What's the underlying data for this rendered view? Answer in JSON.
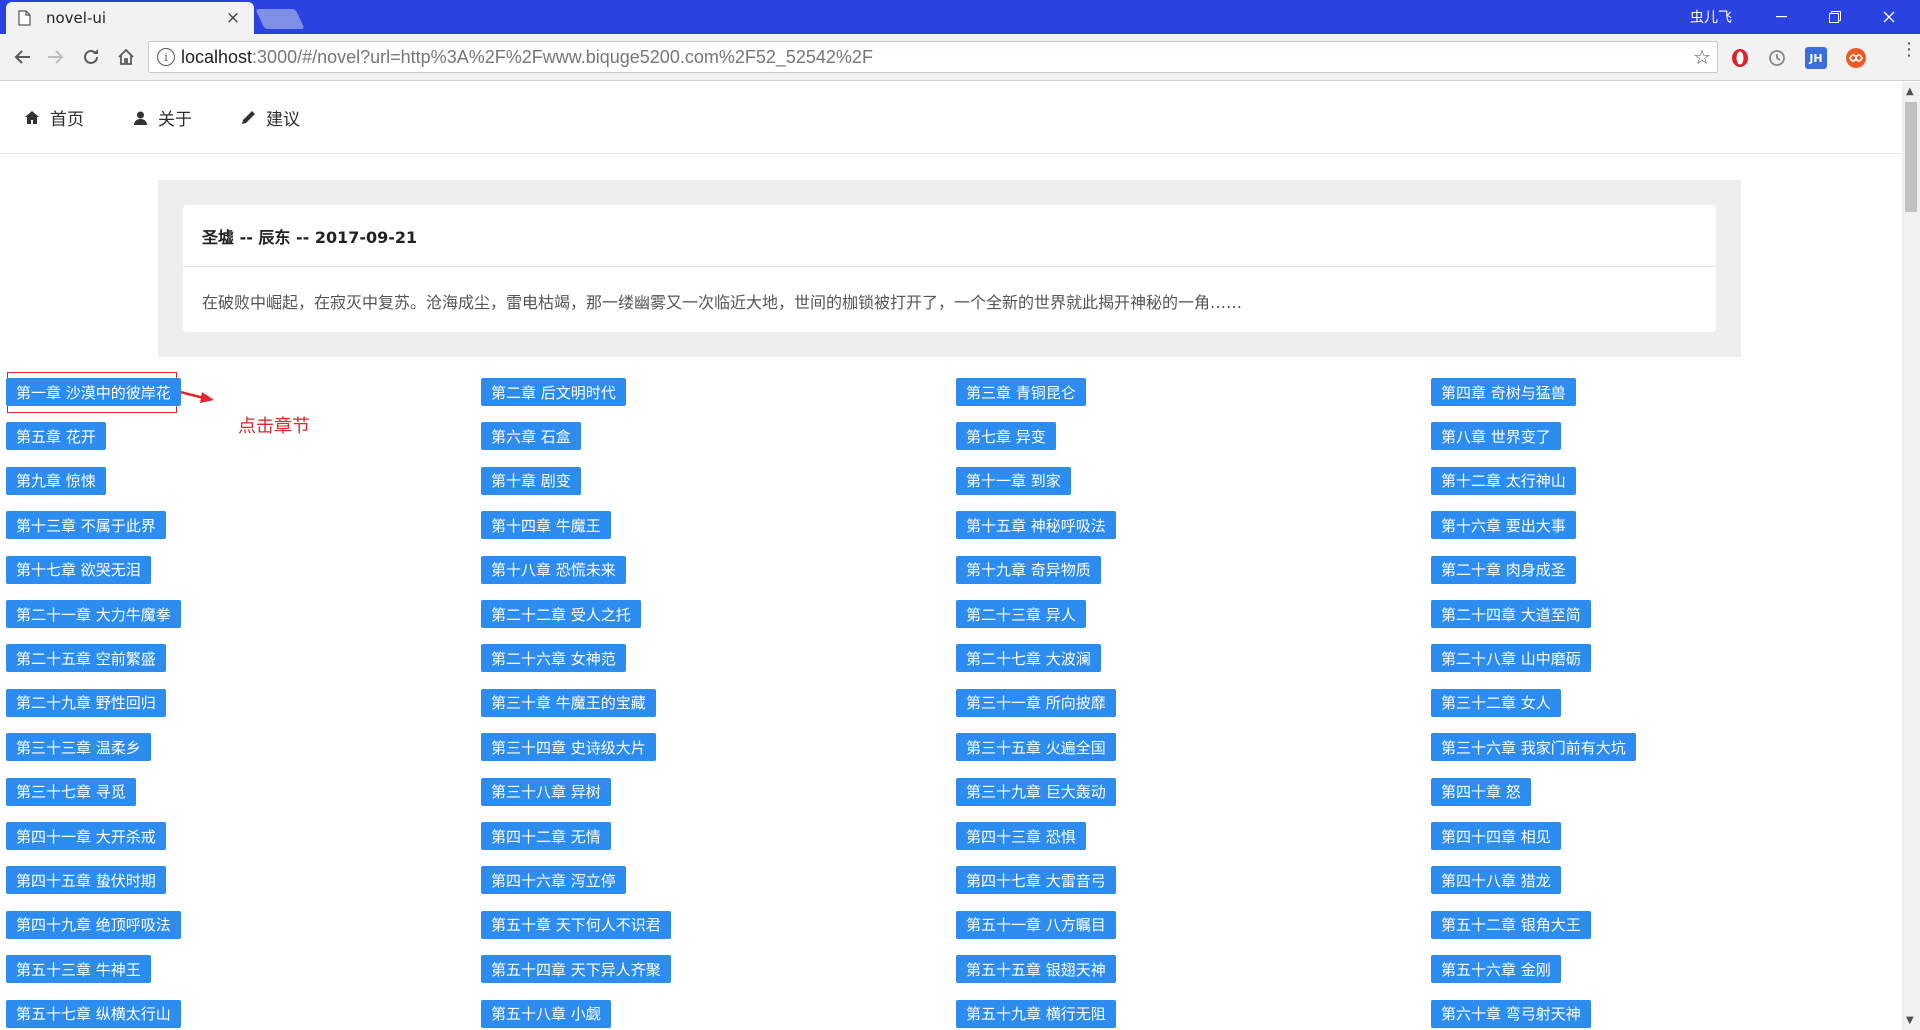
{
  "browser": {
    "tab_title": "novel-ui",
    "tab_close": "×",
    "profile_name": "虫儿飞",
    "url_host": "localhost",
    "url_rest": ":3000/#/novel?url=http%3A%2F%2Fwww.biquge5200.com%2F52_52542%2F",
    "extensions": [
      "opera-icon",
      "history-icon",
      "JH",
      "infinity-icon"
    ]
  },
  "nav": {
    "home": "首页",
    "about": "关于",
    "suggest": "建议"
  },
  "book": {
    "header": "圣墟 -- 辰东 -- 2017-09-21",
    "intro": "在破败中崛起，在寂灭中复苏。沧海成尘，雷电枯竭，那一缕幽雾又一次临近大地，世间的枷锁被打开了，一个全新的世界就此揭开神秘的一角……"
  },
  "annotation": {
    "label": "点击章节"
  },
  "colors": {
    "accent": "#2d8cf0",
    "titlebar": "#2a43e0",
    "annotation": "#e0262a"
  },
  "chapters": [
    "第一章 沙漠中的彼岸花",
    "第二章 后文明时代",
    "第三章 青铜昆仑",
    "第四章 奇树与猛兽",
    "第五章 花开",
    "第六章 石盒",
    "第七章 异变",
    "第八章 世界变了",
    "第九章 惊悚",
    "第十章 剧变",
    "第十一章 到家",
    "第十二章 太行神山",
    "第十三章 不属于此界",
    "第十四章 牛魔王",
    "第十五章 神秘呼吸法",
    "第十六章 要出大事",
    "第十七章 欲哭无泪",
    "第十八章 恐慌未来",
    "第十九章 奇异物质",
    "第二十章 肉身成圣",
    "第二十一章 大力牛魔拳",
    "第二十二章 受人之托",
    "第二十三章 异人",
    "第二十四章 大道至简",
    "第二十五章 空前繁盛",
    "第二十六章 女神范",
    "第二十七章 大波澜",
    "第二十八章 山中磨砺",
    "第二十九章 野性回归",
    "第三十章 牛魔王的宝藏",
    "第三十一章 所向披靡",
    "第三十二章 女人",
    "第三十三章 温柔乡",
    "第三十四章 史诗级大片",
    "第三十五章 火遍全国",
    "第三十六章 我家门前有大坑",
    "第三十七章 寻觅",
    "第三十八章 异树",
    "第三十九章 巨大轰动",
    "第四十章 怒",
    "第四十一章 大开杀戒",
    "第四十二章 无情",
    "第四十三章 恐惧",
    "第四十四章 相见",
    "第四十五章 蛰伏时期",
    "第四十六章 泻立停",
    "第四十七章 大雷音弓",
    "第四十八章 猎龙",
    "第四十九章 绝顶呼吸法",
    "第五十章 天下何人不识君",
    "第五十一章 八方瞩目",
    "第五十二章 银角大王",
    "第五十三章 牛神王",
    "第五十四章 天下异人齐聚",
    "第五十五章 银翅天神",
    "第五十六章 金刚",
    "第五十七章 纵横太行山",
    "第五十八章 小觑",
    "第五十九章 横行无阻",
    "第六十章 弯弓射天神"
  ]
}
